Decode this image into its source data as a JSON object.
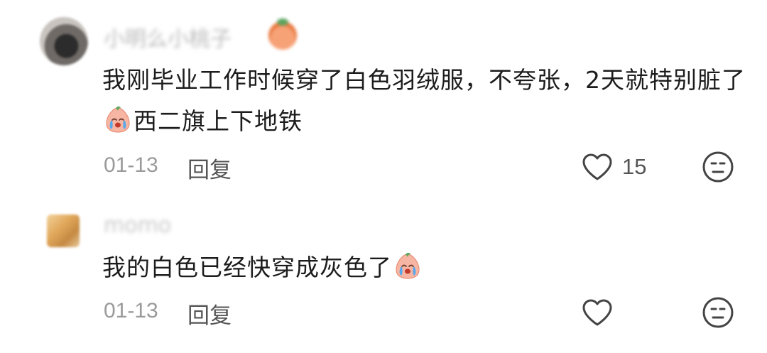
{
  "comments": [
    {
      "username": "小明么小桃子",
      "text_part1": "我刚毕业工作时候穿了白色羽绒服，不夸张，2天就特别脏了",
      "emoji": "crying-peach-sticker",
      "text_part2": "西二旗上下地铁",
      "timestamp": "01-13",
      "reply_label": "回复",
      "like_count": "15"
    },
    {
      "username": "momo",
      "text_part1": "我的白色已经快穿成灰色了",
      "emoji": "crying-peach-sticker",
      "timestamp": "01-13",
      "reply_label": "回复",
      "like_count": ""
    }
  ],
  "colors": {
    "text": "#1c1c1c",
    "meta": "#9a9a9a",
    "icon": "#555555"
  }
}
